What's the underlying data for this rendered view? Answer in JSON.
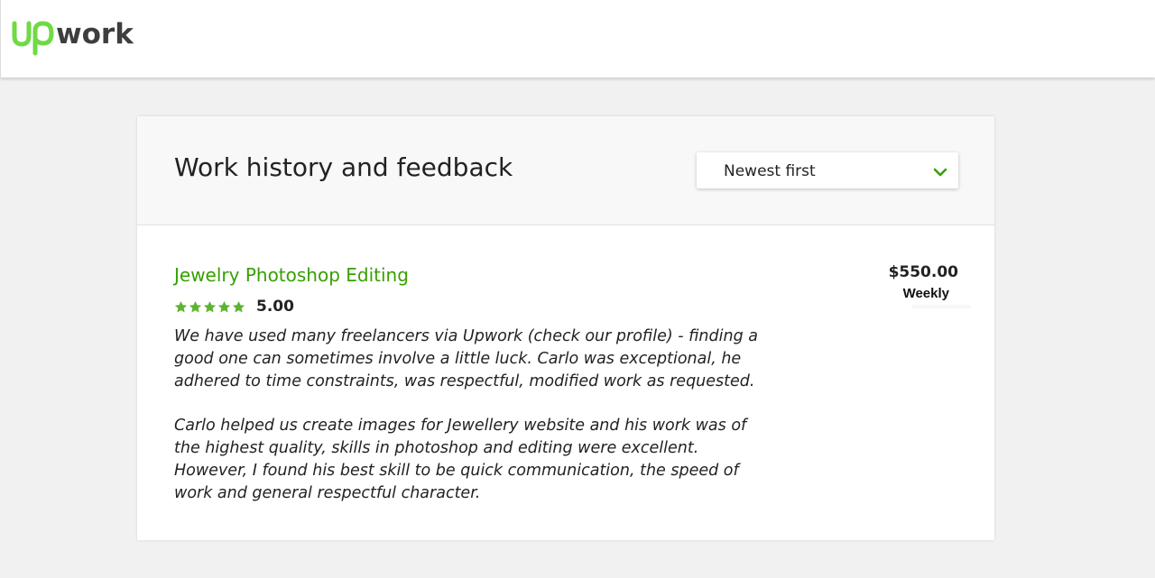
{
  "header": {
    "logo": {
      "text_up": "up",
      "text_work": "work",
      "brand_green": "#6fda44",
      "brand_dark": "#3e3e3e",
      "icon": "upwork-logo"
    }
  },
  "section": {
    "title": "Work history and feedback",
    "sort": {
      "selected": "Newest first",
      "icon": "chevron-down-icon",
      "accent": "#37a000"
    }
  },
  "jobs": [
    {
      "title": "Jewelry Photoshop Editing",
      "stars": 5,
      "rating": "5.00",
      "amount": "$550.00",
      "rate_type": "Weekly",
      "feedback": [
        "We have used many freelancers via Upwork (check our profile) - finding a good one can sometimes involve a little luck. Carlo was exceptional, he adhered to time constraints, was respectful, modified work as requested.",
        "Carlo helped us create images for Jewellery website and his work was of the highest quality, skills in photoshop and editing were excellent. However, I found his best skill to be quick communication, the speed of work and general respectful character."
      ]
    }
  ],
  "colors": {
    "link_green": "#37a000",
    "star_green": "#5cb531",
    "page_bg": "#f1f1f1"
  }
}
